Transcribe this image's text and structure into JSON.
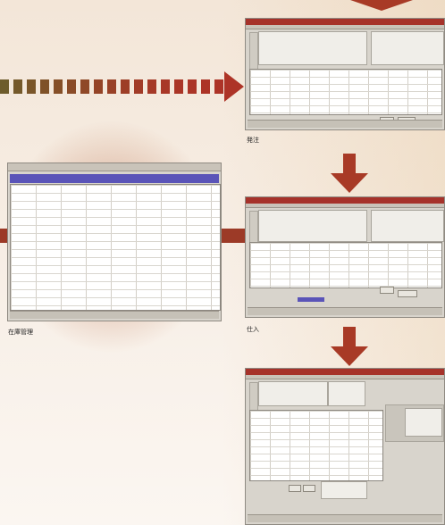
{
  "captions": {
    "order": "発注",
    "purchase": "仕入",
    "inventory": "在庫管理"
  },
  "colors": {
    "arrow": "#a83a26",
    "titlebar": "#a6322a",
    "accent_blue": "#5a54b8"
  },
  "icons": [
    "arrow-right-icon",
    "arrow-down-icon"
  ]
}
